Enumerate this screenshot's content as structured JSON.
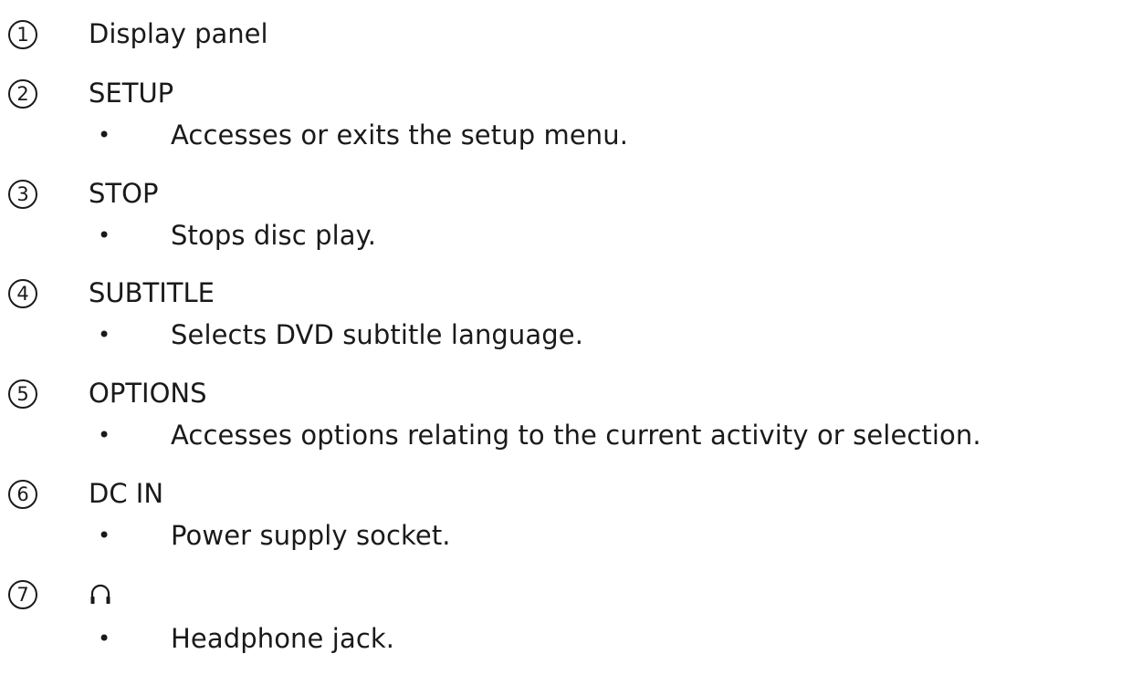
{
  "items": [
    {
      "number": "1",
      "title": "Display panel"
    },
    {
      "number": "2",
      "title": "SETUP",
      "description": "Accesses or exits the setup menu."
    },
    {
      "number": "3",
      "title": "STOP",
      "description": "Stops disc play."
    },
    {
      "number": "4",
      "title": "SUBTITLE",
      "description": "Selects DVD subtitle language."
    },
    {
      "number": "5",
      "title": "OPTIONS",
      "description": "Accesses options relating to the current activity or selection."
    },
    {
      "number": "6",
      "title": "DC IN",
      "description": "Power supply socket."
    },
    {
      "number": "7",
      "icon": "headphone-icon",
      "description": "Headphone jack."
    }
  ],
  "bullet": "•"
}
